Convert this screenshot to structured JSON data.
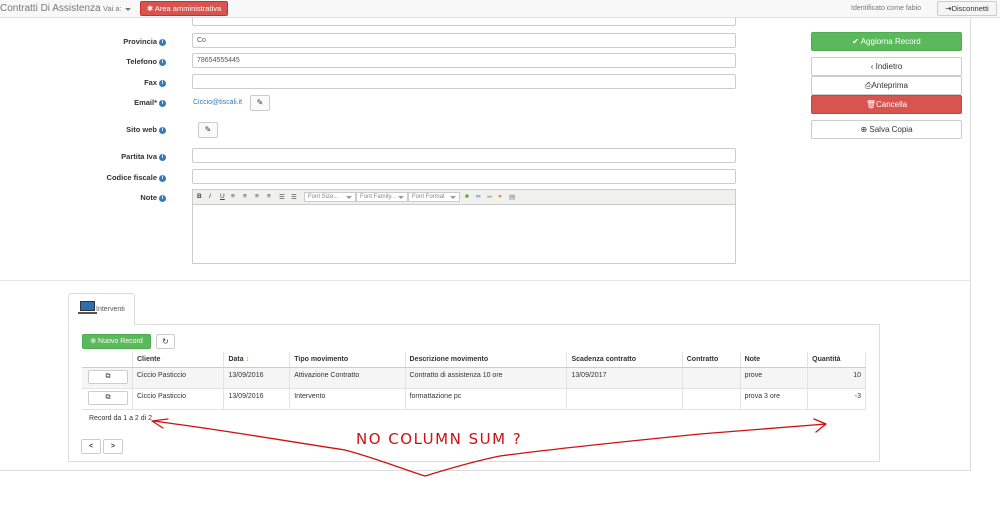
{
  "header": {
    "brand": "Contratti Di Assistenza",
    "nav_dropdown": "Vai a:",
    "admin_button": "Area amministrativa",
    "user_text": "Identificato come fabio",
    "logout_button": "Disconnetti"
  },
  "form": {
    "provincia": {
      "label": "Provincia",
      "value": "Co"
    },
    "telefono": {
      "label": "Telefono",
      "value": "78654555445"
    },
    "fax": {
      "label": "Fax",
      "value": ""
    },
    "email": {
      "label": "Email*",
      "value": "Ciccio@tiscali.it"
    },
    "sito_web": {
      "label": "Sito web"
    },
    "partita_iva": {
      "label": "Partita Iva",
      "value": ""
    },
    "codice_fiscale": {
      "label": "Codice fiscale",
      "value": ""
    },
    "note": {
      "label": "Note"
    }
  },
  "editor_toolbar": {
    "bold": "B",
    "italic": "I",
    "underline": "U",
    "font_size": "Font Size...",
    "font_family": "Font Family...",
    "font_format": "Font Format"
  },
  "actions": {
    "update": "Aggiorna Record",
    "back": "Indietro",
    "preview": "Anteprima",
    "delete": "Cancella",
    "save_copy": "Salva Copia"
  },
  "tab": {
    "label": "Interventi"
  },
  "grid": {
    "new_button": "Nuovo Record",
    "columns": [
      "Cliente",
      "Data",
      "Tipo movimento",
      "Descrizione movimento",
      "Scadenza contratto",
      "Contratto",
      "Note",
      "Quantità"
    ],
    "rows": [
      {
        "cliente": "Ciccio Pasticcio",
        "data": "13/09/2016",
        "tipo": "Attivazione Contratto",
        "descrizione": "Contratto di assistenza 10 ore",
        "scadenza": "13/09/2017",
        "contratto": "",
        "note": "prove",
        "quantita": "10"
      },
      {
        "cliente": "Ciccio Pasticcio",
        "data": "13/09/2016",
        "tipo": "Intervento",
        "descrizione": "formattazione pc",
        "scadenza": "",
        "contratto": "",
        "note": "prova 3 ore",
        "quantita": "-3"
      }
    ],
    "record_info": "Record da 1 a 2 di 2",
    "prev": "<",
    "next": ">"
  },
  "annotation": {
    "text": "NO COLUMN SUM ?",
    "color": "#d01010"
  }
}
